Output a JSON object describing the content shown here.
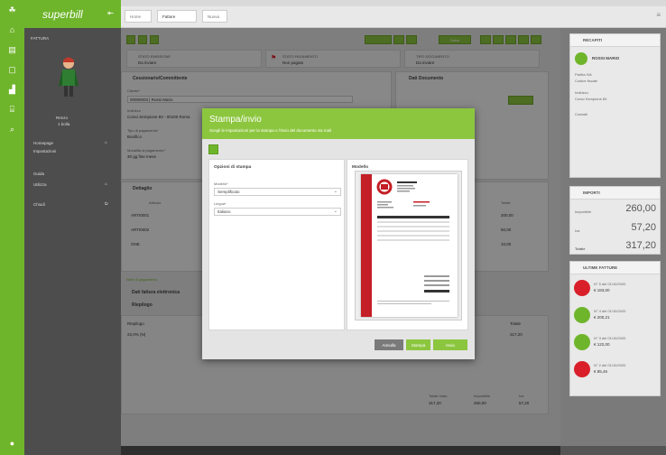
{
  "brand": {
    "name": "superbill"
  },
  "tabs": [
    {
      "label": "Home"
    },
    {
      "label": "Fatture"
    },
    {
      "label": "Nuova"
    }
  ],
  "left_nav": {
    "section": "FATTURA",
    "user": {
      "name": "Renzo",
      "sub": "1 bolla"
    },
    "items": [
      {
        "label": "Homepage"
      },
      {
        "label": "Impostazioni"
      },
      {
        "label": "Guida"
      },
      {
        "label": "Utilizza"
      },
      {
        "label": "Chiudi"
      }
    ]
  },
  "status_cards": [
    {
      "label": "STATO EMISSIONE",
      "value": "Da inviare"
    },
    {
      "label": "STATO PAGAMENTO",
      "value": "Non pagato"
    },
    {
      "label": "TIPO DOCUMENTO",
      "value": "Da inviare"
    }
  ],
  "main": {
    "customer_title": "Cessionario/Committente",
    "doc_title": "Dati Documento",
    "client_label": "Cliente*",
    "client_value": "00000003 | Rossi Mario",
    "address_label": "Indirizzo",
    "address_value": "Corso Sempione 83 - 00100 Roma",
    "payment_label": "Tipo di pagamento*",
    "payment_value": "Bonifico",
    "mode_label": "Modalità di pagamento*",
    "mode_value": "30 gg fine mese",
    "detail_title": "Dettaglio",
    "notes_label": "Note di pagamento",
    "ei_title": "Dati fattura elettronica",
    "summary_title": "Riepilogo",
    "summary_rows": [
      {
        "label": "Riepilogo",
        "value": "Totale"
      },
      {
        "label": "22,0% (N)",
        "value": "317,20"
      }
    ],
    "table_headers": [
      "Articolo",
      "Descrizione",
      "Prezzo",
      "Totale"
    ],
    "table_rows": [
      {
        "code": "ARTI0001",
        "total": "200,00"
      },
      {
        "code": "ARTI0002",
        "total": "50,00"
      },
      {
        "code": "ONE",
        "total": "10,00"
      }
    ],
    "totals": [
      {
        "label": "Totale Ivato",
        "value": "317,20"
      },
      {
        "label": "Imponibile",
        "value": "260,00"
      },
      {
        "label": "Iva",
        "value": "57,20"
      }
    ]
  },
  "right_panel": {
    "recap_title": "RECAPITI",
    "recap_name": "ROSSI MARIO",
    "recap_lines": [
      "Partita IVA",
      "Codice fiscale",
      "Indirizzo",
      "Corso Sempione 83",
      "Contatti"
    ],
    "amounts_title": "IMPORTI",
    "amounts": [
      {
        "label": "Imponibile",
        "value": "260,00"
      },
      {
        "label": "Iva",
        "value": "57,20"
      },
      {
        "label": "Totale",
        "value": "317,20"
      }
    ],
    "last_title": "ULTIME FATTURE",
    "last_invoices": [
      {
        "num": "N° 5 del 01/10/2020",
        "amount": "€ 183,00",
        "color": "#d9202a"
      },
      {
        "num": "N° 4 del 01/10/2020",
        "amount": "€ 200,21",
        "color": "#6fb52c"
      },
      {
        "num": "N° 3 del 01/10/2020",
        "amount": "€ 122,00",
        "color": "#6fb52c"
      },
      {
        "num": "N° 2 del 01/10/2020",
        "amount": "€ 85,46",
        "color": "#d9202a"
      }
    ]
  },
  "toolbar": {
    "save_label": "Salva"
  },
  "modal": {
    "title": "Stampa/invio",
    "subtitle": "Scegli le impostazioni per la stampa o l'invio del documento via mail",
    "options_title": "Opzioni di stampa",
    "preview_title": "Modello",
    "model_label": "Modello*",
    "model_value": "Semplificato",
    "language_label": "Lingua*",
    "language_value": "Italiano",
    "buttons": {
      "cancel": "Annulla",
      "print": "Stampa",
      "send": "Invia"
    }
  },
  "colors": {
    "accent": "#8cc63f",
    "rail": "#6fb52c",
    "nav": "#4d4d4d",
    "red": "#d9202a"
  }
}
